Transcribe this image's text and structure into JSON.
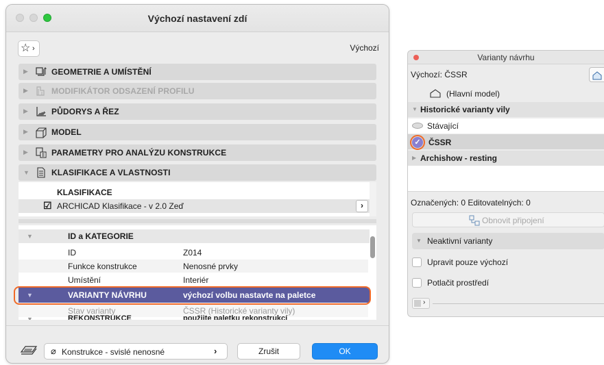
{
  "dialog": {
    "title": "Výchozí nastavení zdí",
    "favorites_arrow": "›",
    "default_label": "Výchozí",
    "sections": [
      {
        "label": "GEOMETRIE A UMÍSTĚNÍ",
        "icon": "geometry-icon"
      },
      {
        "label": "MODIFIKÁTOR ODSAZENÍ PROFILU",
        "icon": "profile-offset-icon"
      },
      {
        "label": "PŮDORYS A ŘEZ",
        "icon": "floorplan-section-icon"
      },
      {
        "label": "MODEL",
        "icon": "model-icon"
      },
      {
        "label": "PARAMETRY PRO ANALÝZU KONSTRUKCE",
        "icon": "structural-analysis-icon"
      },
      {
        "label": "KLASIFIKACE A VLASTNOSTI",
        "icon": "classification-icon"
      }
    ],
    "classification": {
      "header": "KLASIFIKACE",
      "item": "ARCHICAD Klasifikace - v 2.0 Zeď",
      "arrow": "›"
    },
    "properties": {
      "group_id": "ID a KATEGORIE",
      "rows": [
        {
          "name": "ID",
          "value": "Z014"
        },
        {
          "name": "Funkce konstrukce",
          "value": "Nenosné prvky"
        },
        {
          "name": "Umístění",
          "value": "Interiér"
        }
      ],
      "highlight": {
        "name": "VARIANTY NÁVRHU",
        "value": "výchozí volbu nastavte na paletce"
      },
      "variant_row": {
        "name": "Stav varianty",
        "value": "ČSSR (Historické varianty vily)"
      },
      "cut_row": {
        "name": "REKONSTRUKCE",
        "value": "použijte paletku rekonstrukcí"
      }
    },
    "footer": {
      "layer": "Konstrukce - svislé nenosné",
      "layer_arrow": "›",
      "cancel": "Zrušit",
      "ok": "OK"
    },
    "colors": {
      "highlight_row": "#5b5b9e",
      "callout": "#f06a28",
      "ok_button": "#1f8cf5"
    }
  },
  "palette": {
    "title": "Varianty návrhu",
    "default_label": "Výchozí: ČSSR",
    "main_model": "(Hlavní model)",
    "group_historic": "Historické varianty vily",
    "variant_existing": "Stávající",
    "variant_cssr": "ČSSR",
    "group_archishow": "Archishow - resting",
    "counts": "Označených: 0 Editovatelných: 0",
    "refresh": "Obnovit připojení",
    "inactive": "Neaktivní varianty",
    "option_default_only": "Upravit pouze výchozí",
    "option_suppress_env": "Potlačit prostředí"
  }
}
